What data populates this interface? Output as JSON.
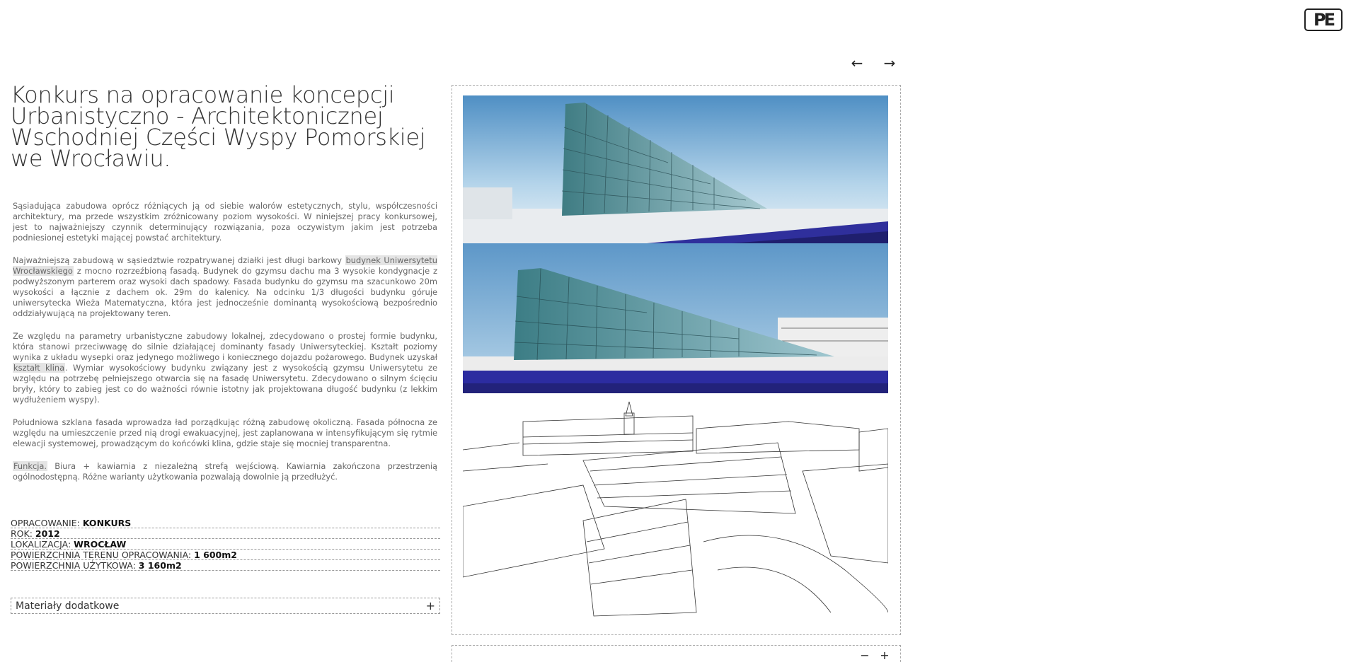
{
  "logo": {
    "text": "PE"
  },
  "nav": {
    "prev_icon": "←",
    "next_icon": "→"
  },
  "title": "Konkurs na opracowanie koncepcji Urbanistyczno - Architektonicznej Wschodniej Części Wyspy Pomorskiej we Wrocławiu.",
  "paragraphs": {
    "p1": "Sąsiadująca zabudowa oprócz różniących ją od siebie walorów estetycznych, stylu, współczesności architektury, ma przede wszystkim zróżnicowany poziom wysokości. W niniejszej pracy konkursowej, jest to najważniejszy czynnik determinujący rozwiązania, poza oczywistym jakim jest potrzeba podniesionej estetyki mającej powstać architektury.",
    "p2_before": "Najważniejszą zabudową w sąsiedztwie rozpatrywanej działki jest długi barkowy ",
    "p2_highlight": "budynek Uniwersytetu Wrocławskiego",
    "p2_after": " z mocno rozrzeźbioną fasadą. Budynek do gzymsu dachu ma 3 wysokie kondygnacje z podwyższonym parterem oraz wysoki dach spadowy. Fasada budynku do gzymsu ma szacunkowo 20m wysokości a łącznie z dachem ok. 29m do kalenicy. Na odcinku 1/3 długości budynku góruje uniwersytecka Wieża Matematyczna, która jest jednocześnie dominantą wysokościową bezpośrednio oddziaływującą na projektowany teren.",
    "p3_before": "Ze względu na parametry urbanistyczne zabudowy lokalnej, zdecydowano o prostej formie budynku, która stanowi przeciwwagę do silnie działającej dominanty fasady Uniwersyteckiej. Kształt poziomy wynika z układu wysepki oraz jedynego możliwego i koniecznego dojazdu pożarowego. Budynek uzyskał ",
    "p3_highlight": "kształt klina",
    "p3_after": ". Wymiar wysokościowy budynku związany jest z wysokością gzymsu Uniwersytetu ze względu na potrzebę pełniejszego otwarcia się na fasadę Uniwersytetu. Zdecydowano o silnym ścięciu bryły, który to zabieg jest co do ważności równie istotny jak projektowana długość budynku (z lekkim wydłużeniem wyspy).",
    "p4": "Południowa szklana fasada wprowadza ład porządkując różną zabudowę okoliczną. Fasada północna ze względu na umieszczenie przed nią drogi ewakuacyjnej, jest zaplanowana w intensyfikującym się rytmie elewacji systemowej, prowadzącym do końcówki klina, gdzie staje się mocniej transparentna.",
    "p5_highlight": "Funkcja.",
    "p5_after": " Biura + kawiarnia z niezależną strefą wejściową. Kawiarnia zakończona przestrzenią ogólnodostępną. Różne warianty użytkowania pozwalają dowolnie ją przedłużyć."
  },
  "specs": [
    {
      "label": "OPRACOWANIE: ",
      "value": "KONKURS"
    },
    {
      "label": "ROK: ",
      "value": "2012"
    },
    {
      "label": "LOKALIZACJA: ",
      "value": "WROCŁAW"
    },
    {
      "label": "POWIERZCHNIA TERENU OPRACOWANIA: ",
      "value": "1 600m2"
    },
    {
      "label": "POWIERZCHNIA UŻYTKOWA: ",
      "value": "3 160m2"
    }
  ],
  "extra": {
    "label": "Materiały dodatkowe",
    "icon": "+"
  },
  "zoom": {
    "minus": "−",
    "plus": "+"
  },
  "colors": {
    "sky": "#7fb4d8",
    "water": "#2f2f9c",
    "glass": "#4c8f95"
  }
}
